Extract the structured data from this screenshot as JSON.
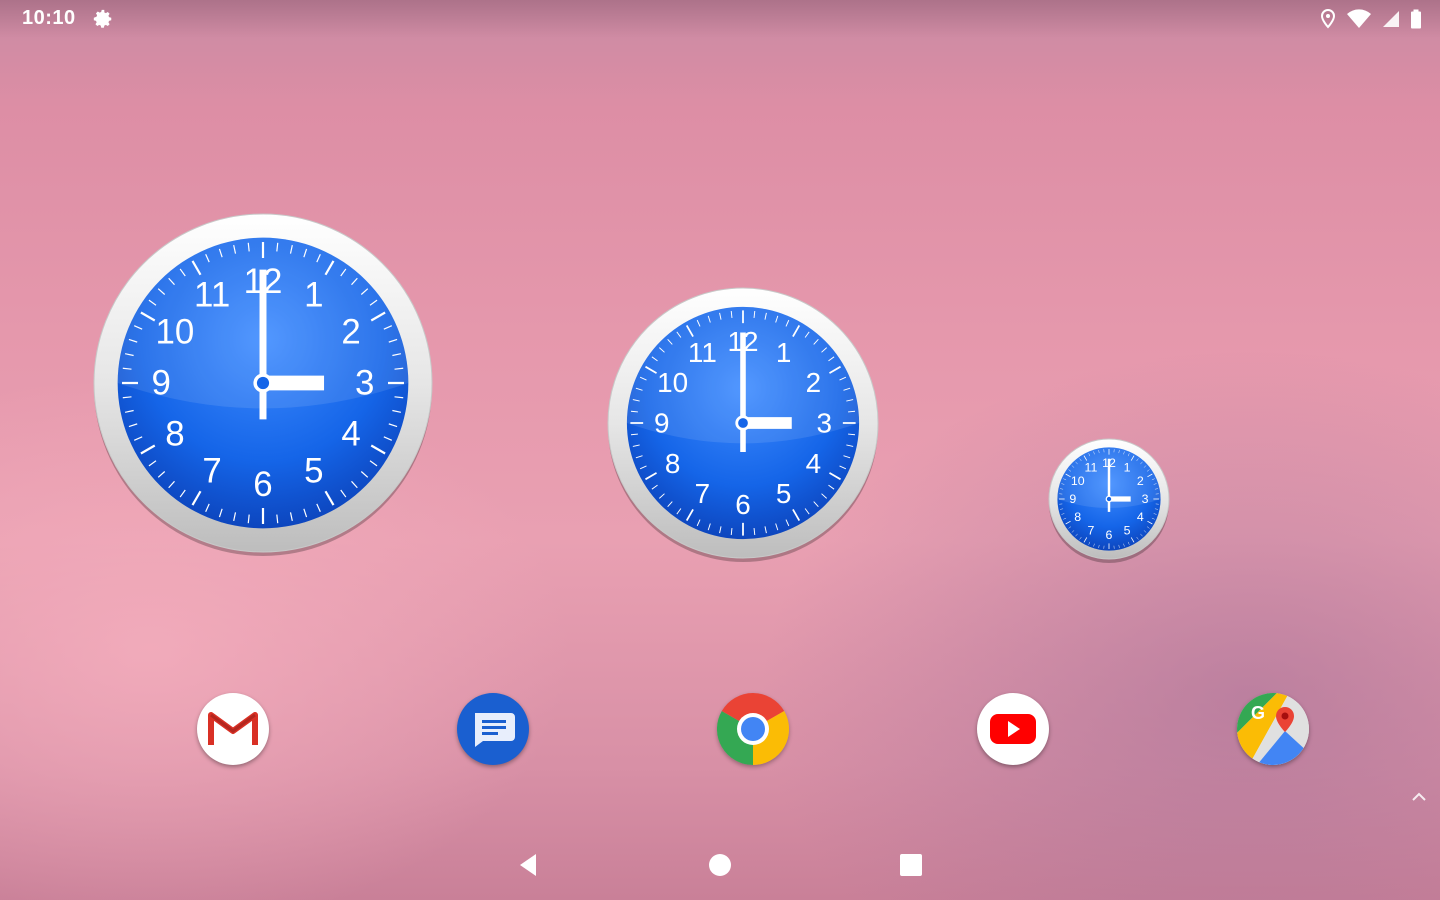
{
  "status_bar": {
    "time": "10:10",
    "icons": [
      "settings-gear-icon",
      "location-icon",
      "wifi-icon",
      "cell-signal-icon",
      "battery-icon"
    ]
  },
  "clock_widgets": {
    "displayed_time": "3:00",
    "numerals": [
      "12",
      "1",
      "2",
      "3",
      "4",
      "5",
      "6",
      "7",
      "8",
      "9",
      "10",
      "11"
    ],
    "dial_color": "#1565e8",
    "bezel_color": "#e6e6e6",
    "sizes": [
      "large",
      "medium",
      "small"
    ]
  },
  "dock": {
    "apps": [
      {
        "name": "Gmail",
        "icon": "gmail-icon"
      },
      {
        "name": "Messages",
        "icon": "messages-icon"
      },
      {
        "name": "Chrome",
        "icon": "chrome-icon"
      },
      {
        "name": "YouTube",
        "icon": "youtube-icon"
      },
      {
        "name": "Maps",
        "icon": "maps-icon"
      }
    ]
  },
  "navigation": {
    "buttons": [
      "back-icon",
      "home-icon",
      "recents-icon"
    ]
  },
  "colors": {
    "wallpaper": "#e699ad",
    "gmail_red": "#d93025",
    "messages_blue": "#1a5fd0",
    "youtube_red": "#ff0000"
  }
}
